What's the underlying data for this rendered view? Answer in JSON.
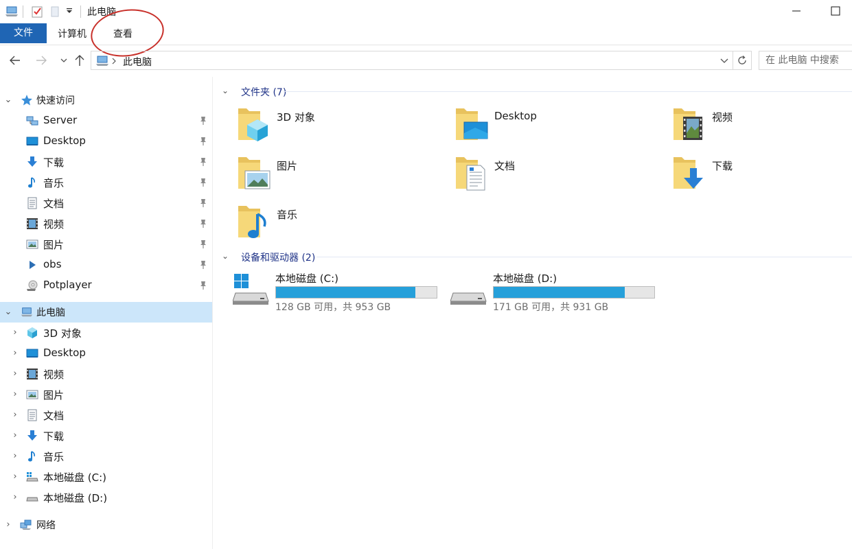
{
  "window": {
    "title": "此电脑"
  },
  "ribbon": {
    "tabs": [
      "文件",
      "计算机",
      "查看"
    ]
  },
  "address": {
    "path": "此电脑",
    "search_placeholder": "在 此电脑 中搜索"
  },
  "sidebar": {
    "quick_access": {
      "label": "快速访问",
      "items": [
        {
          "label": "Server",
          "icon": "network-drive-icon"
        },
        {
          "label": "Desktop",
          "icon": "desktop-icon"
        },
        {
          "label": "下载",
          "icon": "download-icon"
        },
        {
          "label": "音乐",
          "icon": "music-icon"
        },
        {
          "label": "文档",
          "icon": "document-icon"
        },
        {
          "label": "视频",
          "icon": "video-icon"
        },
        {
          "label": "图片",
          "icon": "picture-icon"
        },
        {
          "label": "obs",
          "icon": "play-icon"
        },
        {
          "label": "Potplayer",
          "icon": "disc-icon"
        }
      ]
    },
    "this_pc": {
      "label": "此电脑",
      "items": [
        {
          "label": "3D 对象",
          "icon": "3d-objects-icon"
        },
        {
          "label": "Desktop",
          "icon": "desktop-icon"
        },
        {
          "label": "视频",
          "icon": "video-icon"
        },
        {
          "label": "图片",
          "icon": "picture-icon"
        },
        {
          "label": "文档",
          "icon": "document-icon"
        },
        {
          "label": "下载",
          "icon": "download-icon"
        },
        {
          "label": "音乐",
          "icon": "music-icon"
        },
        {
          "label": "本地磁盘 (C:)",
          "icon": "windows-drive-icon"
        },
        {
          "label": "本地磁盘 (D:)",
          "icon": "drive-icon"
        }
      ]
    },
    "network": {
      "label": "网络"
    }
  },
  "content": {
    "folders_header": "文件夹 (7)",
    "folders": [
      {
        "label": "3D 对象",
        "icon": "3d-objects-icon"
      },
      {
        "label": "Desktop",
        "icon": "desktop-icon"
      },
      {
        "label": "视频",
        "icon": "video-icon"
      },
      {
        "label": "图片",
        "icon": "picture-icon"
      },
      {
        "label": "文档",
        "icon": "document-icon"
      },
      {
        "label": "下载",
        "icon": "download-icon"
      },
      {
        "label": "音乐",
        "icon": "music-icon"
      }
    ],
    "drives_header": "设备和驱动器 (2)",
    "drives": [
      {
        "name": "本地磁盘 (C:)",
        "info": "128 GB 可用，共 953 GB",
        "used_fraction": 0.866,
        "icon": "windows-drive-icon"
      },
      {
        "name": "本地磁盘 (D:)",
        "info": "171 GB 可用，共 931 GB",
        "used_fraction": 0.816,
        "icon": "drive-icon"
      }
    ]
  },
  "colors": {
    "accent": "#1f65b4",
    "selection": "#cce6fa",
    "capacity_bar": "#26a0da",
    "group_header": "#1e3287",
    "annotation": "#c8302a"
  }
}
